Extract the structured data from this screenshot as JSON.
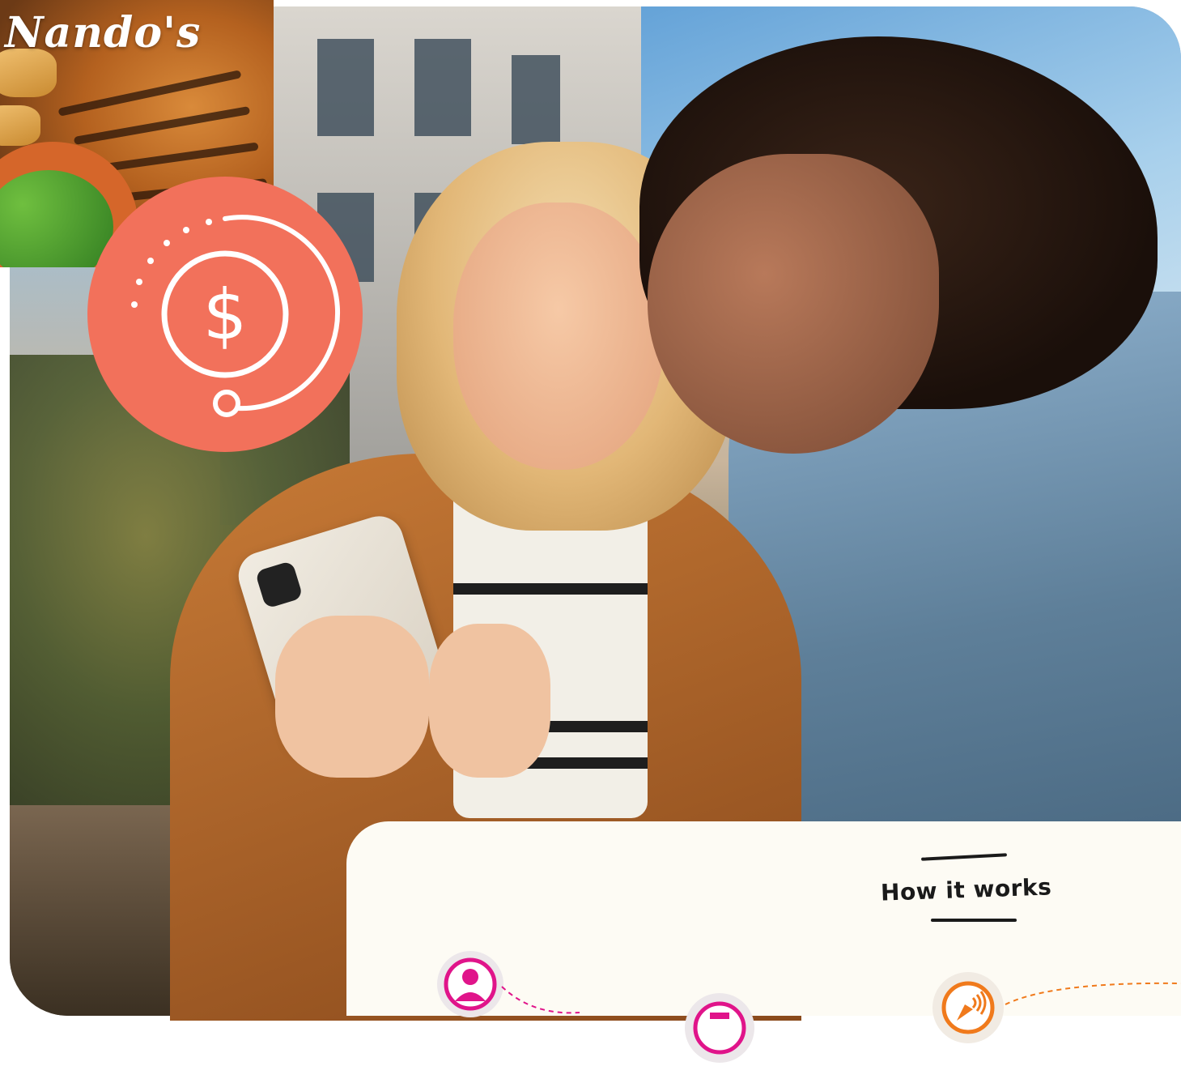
{
  "brand": {
    "logo_text": "Nando's"
  },
  "colors": {
    "badge": "#f2715b",
    "card_bg": "#fdfbf4",
    "step_magenta": "#e0148a",
    "step_orange": "#f07a1c"
  },
  "badge": {
    "icon": "dollar-coin-icon",
    "symbol": "$"
  },
  "how_it_works": {
    "title": "How it works",
    "steps": [
      {
        "icon": "user-profile-icon"
      },
      {
        "icon": "receipt-icon"
      },
      {
        "icon": "contactless-pay-icon"
      }
    ]
  }
}
